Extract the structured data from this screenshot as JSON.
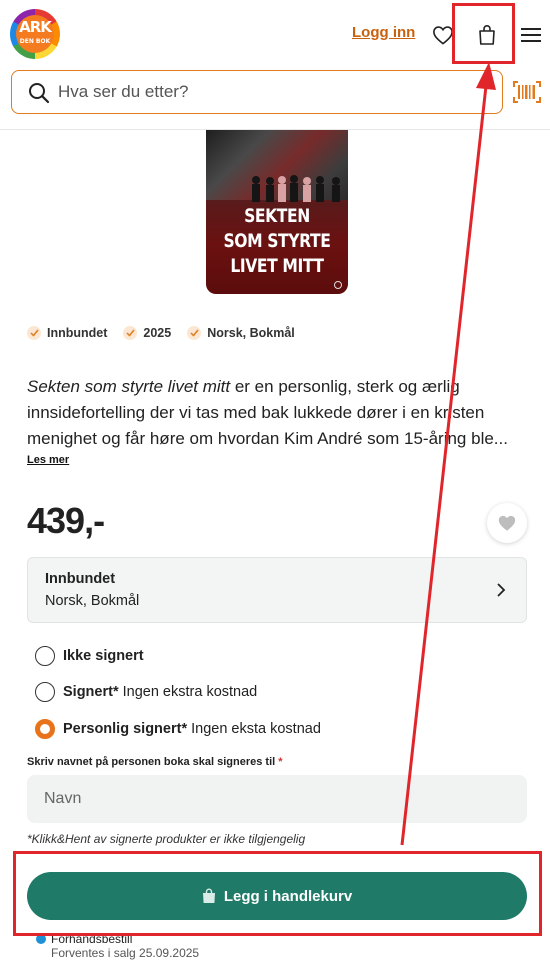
{
  "header": {
    "logo": {
      "line1": "ARK",
      "line2": "DEN BOK"
    },
    "login_label": "Logg inn",
    "icons": {
      "heart": "heart-icon",
      "bag": "shopping-bag-icon",
      "menu": "hamburger-menu-icon",
      "barcode": "barcode-scanner-icon"
    },
    "search": {
      "placeholder": "Hva ser du etter?",
      "value": ""
    }
  },
  "product": {
    "cover": {
      "title_lines": [
        "SEKTEN",
        "SOM STYRTE",
        "LIVET MITT"
      ]
    },
    "attributes": [
      "Innbundet",
      "2025",
      "Norsk, Bokmål"
    ],
    "description": {
      "italic_title": "Sekten som styrte livet mitt",
      "text": " er en personlig, sterk og ærlig innsidefortelling der vi tas med bak lukkede dører i en kristen menighet og får høre om hvordan Kim André som 15-åring ble..."
    },
    "read_more_label": "Les mer",
    "price": "439,-",
    "format": {
      "title": "Innbundet",
      "subtitle": "Norsk, Bokmål"
    },
    "signing_options": [
      {
        "bold": "Ikke signert",
        "rest": "",
        "selected": false
      },
      {
        "bold": "Signert*",
        "rest": " Ingen ekstra kostnad",
        "selected": false
      },
      {
        "bold": "Personlig signert*",
        "rest": " Ingen eksta kostnad",
        "selected": true
      }
    ],
    "name_field": {
      "label": "Skriv navnet på personen boka skal signeres til",
      "required_mark": "*",
      "placeholder": "Navn",
      "value": ""
    },
    "note": "*Klikk&Hent av signerte produkter er ikke tilgjengelig",
    "cart_button_label": "Legg i handlekurv",
    "preorder_label": "Forhåndsbestill",
    "expected_label": "Forventes i salg 25.09.2025"
  },
  "colors": {
    "accent": "#e8731a",
    "primary": "#1f7a68",
    "annotation": "#e0262b"
  }
}
